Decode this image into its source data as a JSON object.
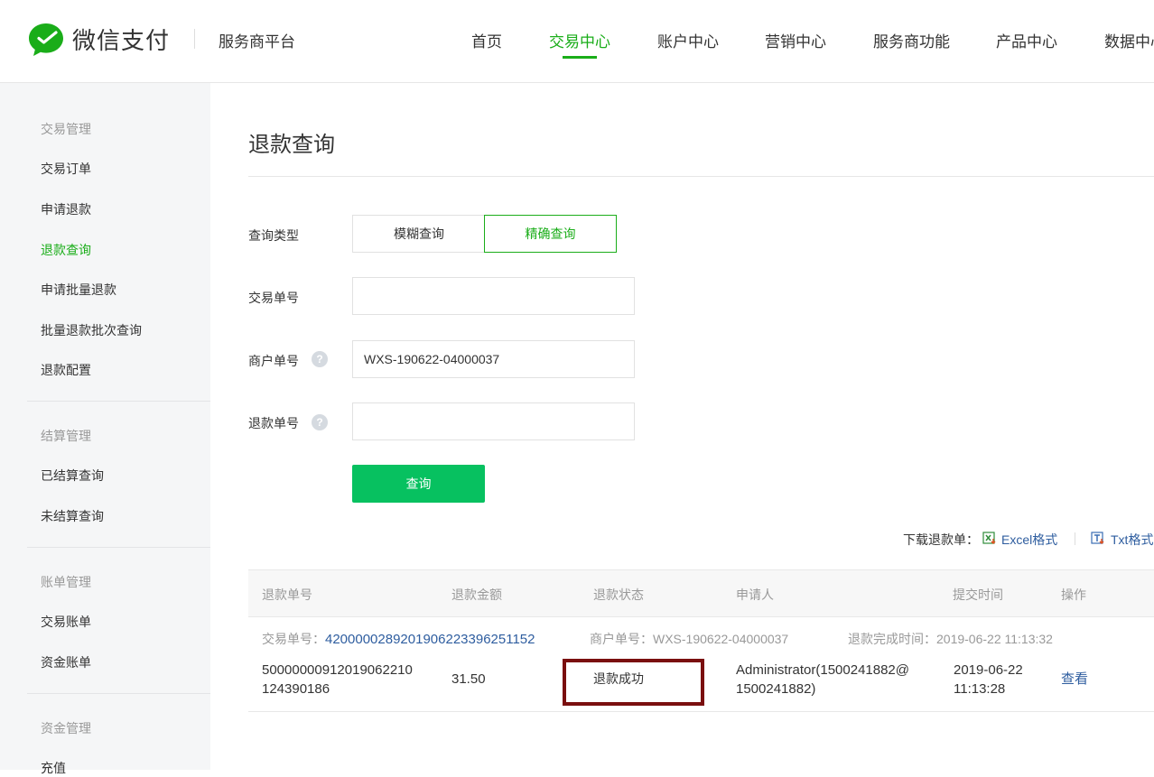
{
  "brand": {
    "name": "微信支付",
    "platform": "服务商平台"
  },
  "nav": [
    "首页",
    "交易中心",
    "账户中心",
    "营销中心",
    "服务商功能",
    "产品中心",
    "数据中心"
  ],
  "sidebar": {
    "groups": [
      {
        "title": "交易管理",
        "items": [
          "交易订单",
          "申请退款",
          "退款查询",
          "申请批量退款",
          "批量退款批次查询",
          "退款配置"
        ]
      },
      {
        "title": "结算管理",
        "items": [
          "已结算查询",
          "未结算查询"
        ]
      },
      {
        "title": "账单管理",
        "items": [
          "交易账单",
          "资金账单"
        ]
      },
      {
        "title": "资金管理",
        "items": [
          "充值"
        ]
      }
    ]
  },
  "page": {
    "title": "退款查询"
  },
  "form": {
    "query_type_label": "查询类型",
    "query_type_options": [
      "模糊查询",
      "精确查询"
    ],
    "trade_no_label": "交易单号",
    "trade_no_value": "",
    "merchant_no_label": "商户单号",
    "merchant_no_value": "WXS-190622-04000037",
    "refund_no_label": "退款单号",
    "refund_no_value": "",
    "help_mark": "?",
    "submit_label": "查询"
  },
  "download": {
    "label": "下载退款单：",
    "excel": "Excel格式",
    "txt": "Txt格式"
  },
  "table": {
    "headers": [
      "退款单号",
      "退款金额",
      "退款状态",
      "申请人",
      "提交时间",
      "操作"
    ],
    "row": {
      "trade_no_label": "交易单号：",
      "trade_no": "4200000289201906223396251152",
      "merchant_no": "商户单号：WXS-190622-04000037",
      "complete_time": "退款完成时间：2019-06-22 11:13:32",
      "refund_no_line1": "50000000912019062210",
      "refund_no_line2": "124390186",
      "amount": "31.50",
      "status": "退款成功",
      "applicant_line1": "Administrator(1500241882@",
      "applicant_line2": "1500241882)",
      "submit_date": "2019-06-22",
      "submit_time": "11:13:28",
      "action": "查看"
    }
  },
  "colors": {
    "accent": "#1aad19",
    "button": "#07c160",
    "link": "#2e5d9f",
    "highlight_box": "#7a0f0f"
  }
}
